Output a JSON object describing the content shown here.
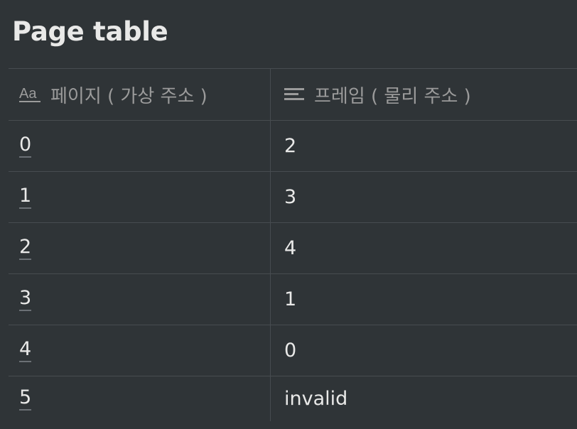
{
  "page": {
    "title": "Page table"
  },
  "table": {
    "columns": [
      {
        "label": "페이지 ( 가상 주소 )",
        "icon": "title-property-icon"
      },
      {
        "label": "프레임 ( 물리 주소 )",
        "icon": "text-property-icon"
      }
    ],
    "rows": [
      {
        "page": "0",
        "frame": "2"
      },
      {
        "page": "1",
        "frame": "3"
      },
      {
        "page": "2",
        "frame": "4"
      },
      {
        "page": "3",
        "frame": "1"
      },
      {
        "page": "4",
        "frame": "0"
      },
      {
        "page": "5",
        "frame": "invalid"
      }
    ]
  }
}
